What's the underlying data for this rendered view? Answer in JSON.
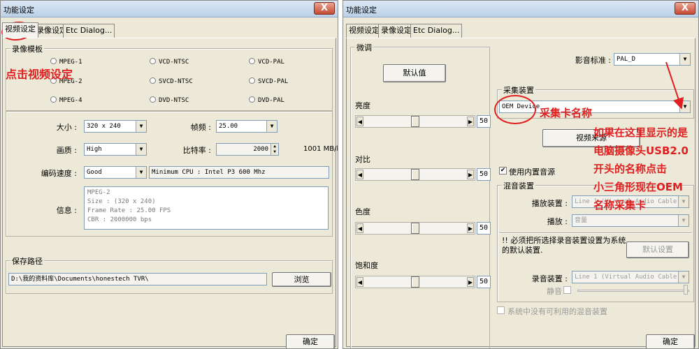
{
  "colors": {
    "annotation": "#e02020",
    "window_bg": "#ece9d8",
    "titlebar": "#bcd1e8"
  },
  "left": {
    "title": "功能设定",
    "close_label": "X",
    "tabs": [
      "视频设定",
      "录像设定",
      "Etc Dialog..."
    ],
    "template_group": {
      "title": "录像模板",
      "options": [
        "MPEG-1",
        "VCD-NTSC",
        "VCD-PAL",
        "MPEG-2",
        "SVCD-NTSC",
        "SVCD-PAL",
        "MPEG-4",
        "DVD-NTSC",
        "DVD-PAL"
      ]
    },
    "size_label": "大小 :",
    "size_value": "320 x 240",
    "framerate_label": "帧频 :",
    "framerate_value": "25.00",
    "quality_label": "画质 :",
    "quality_value": "High",
    "bitrate_label": "比特率 :",
    "bitrate_value": "2000",
    "bitrate_unit": "1001 MB/h",
    "encode_label": "编码速度 :",
    "encode_value": "Good",
    "encode_cpu": "Minimum CPU : Intel P3 600 Mhz",
    "info_label": "信息 :",
    "info_lines": [
      "MPEG-2",
      "Size : (320 x 240)",
      "Frame Rate : 25.00 FPS",
      "CBR : 2000000 bps"
    ],
    "save_group_title": "保存路径",
    "save_path": "D:\\我的资料库\\Documents\\honestech TVR\\",
    "browse_label": "浏览",
    "ok_label": "确定",
    "annotation": "点击视频设定"
  },
  "right": {
    "title": "功能设定",
    "close_label": "X",
    "tabs": [
      "视频设定",
      "录像设定",
      "Etc Dialog..."
    ],
    "adjust_group_title": "微调",
    "default_button": "默认值",
    "sliders": [
      {
        "label": "亮度",
        "value": 50,
        "position": 0.5
      },
      {
        "label": "对比",
        "value": 50,
        "position": 0.5
      },
      {
        "label": "色度",
        "value": 50,
        "position": 0.5
      },
      {
        "label": "饱和度",
        "value": 50,
        "position": 0.5
      }
    ],
    "video_standard_label": "影音标准 :",
    "video_standard_value": "PAL_D",
    "capture_group_title": "采集装置",
    "capture_device_value": "OEM Device",
    "video_source_button": "视频来源",
    "builtin_audio_label": "使用内置音源",
    "mixer_group_title": "混音装置",
    "playback_device_label": "播放装置 :",
    "playback_device_value": "Line 1 (Virtual Audio Cable)",
    "playback_label": "播放 :",
    "playback_value": "音量",
    "warning_text": "!! 必须把所选择录音装置设置为系统的默认装置.",
    "default_settings_button": "默认设置",
    "record_device_label": "录音装置 :",
    "record_device_value": "Line 1 (Virtual Audio Cable)",
    "mute_label": "静音",
    "no_mixer_label": "系统中没有可利用的混音装置",
    "ok_label": "确定",
    "annotation_capture": "采集卡名称",
    "annotation_note_lines": [
      "如果在这里显示的是",
      "电脑摄像头USB2.0",
      "开头的名称点击",
      "小三角形现在OEM",
      "名称采集卡"
    ]
  }
}
